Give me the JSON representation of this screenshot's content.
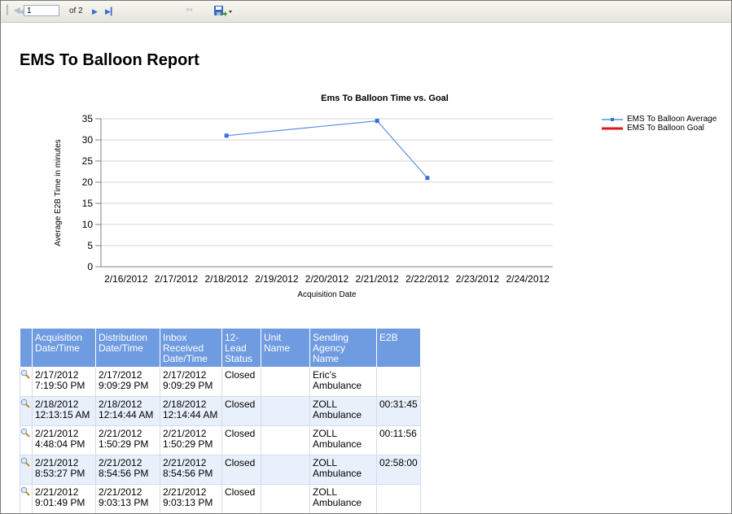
{
  "toolbar": {
    "first_page_icon": "first-page-icon",
    "prev_page_icon": "previous-page-icon",
    "current_page": "1",
    "of_pages": "of 2",
    "next_page_icon": "next-page-icon",
    "last_page_icon": "last-page-icon",
    "back_icon": "back-to-parent-icon",
    "export_icon": "export-save-icon"
  },
  "report": {
    "title": "EMS To Balloon Report"
  },
  "chart_data": {
    "type": "line",
    "title": "Ems To Balloon Time vs. Goal",
    "xlabel": "Acquisition Date",
    "ylabel": "Average E2B Time in minutes",
    "ylim": [
      0,
      35
    ],
    "yticks": [
      "0",
      "5",
      "10",
      "15",
      "20",
      "25",
      "30",
      "35"
    ],
    "x_ticks": [
      "2/16/2012",
      "2/17/2012",
      "2/18/2012",
      "2/19/2012",
      "2/20/2012",
      "2/21/2012",
      "2/22/2012",
      "2/23/2012",
      "2/24/2012"
    ],
    "legend_position": "right",
    "series": [
      {
        "name": "EMS To Balloon Average",
        "color": "#5b8fe0",
        "points": [
          {
            "x": "2/18/2012",
            "y": 31
          },
          {
            "x": "2/21/2012",
            "y": 34.5
          },
          {
            "x": "2/22/2012",
            "y": 21
          }
        ]
      },
      {
        "name": "EMS To Balloon Goal",
        "color": "#e01818",
        "points": []
      }
    ]
  },
  "table": {
    "columns": [
      "Acquisition Date/Time",
      "Distribution Date/Time",
      "Inbox Received Date/Time",
      "12-Lead Status",
      "Unit Name",
      "Sending Agency Name",
      "E2B"
    ],
    "rows": [
      {
        "acq": [
          "2/17/2012",
          "7:19:50 PM"
        ],
        "dist": [
          "2/17/2012",
          "9:09:29 PM"
        ],
        "inbox": [
          "2/17/2012",
          "9:09:29 PM"
        ],
        "status": "Closed",
        "unit": "",
        "agency": [
          "Eric's",
          "Ambulance"
        ],
        "e2b": ""
      },
      {
        "acq": [
          "2/18/2012",
          "12:13:15 AM"
        ],
        "dist": [
          "2/18/2012",
          "12:14:44 AM"
        ],
        "inbox": [
          "2/18/2012",
          "12:14:44 AM"
        ],
        "status": "Closed",
        "unit": "",
        "agency": [
          "ZOLL",
          "Ambulance"
        ],
        "e2b": "00:31:45"
      },
      {
        "acq": [
          "2/21/2012",
          "4:48:04 PM"
        ],
        "dist": [
          "2/21/2012",
          "1:50:29 PM"
        ],
        "inbox": [
          "2/21/2012",
          "1:50:29 PM"
        ],
        "status": "Closed",
        "unit": "",
        "agency": [
          "ZOLL",
          "Ambulance"
        ],
        "e2b": "00:11:56"
      },
      {
        "acq": [
          "2/21/2012",
          "8:53:27 PM"
        ],
        "dist": [
          "2/21/2012",
          "8:54:56 PM"
        ],
        "inbox": [
          "2/21/2012",
          "8:54:56 PM"
        ],
        "status": "Closed",
        "unit": "",
        "agency": [
          "ZOLL",
          "Ambulance"
        ],
        "e2b": "02:58:00"
      },
      {
        "acq": [
          "2/21/2012",
          "9:01:49 PM"
        ],
        "dist": [
          "2/21/2012",
          "9:03:13 PM"
        ],
        "inbox": [
          "2/21/2012",
          "9:03:13 PM"
        ],
        "status": "Closed",
        "unit": "",
        "agency": [
          "ZOLL",
          "Ambulance"
        ],
        "e2b": ""
      }
    ]
  }
}
